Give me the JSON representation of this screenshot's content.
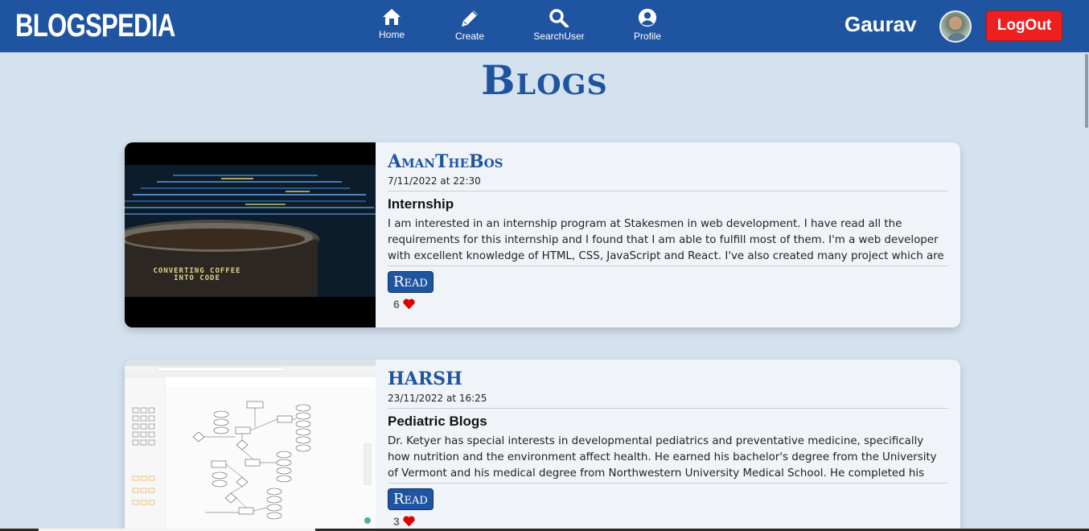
{
  "brand": "BLOGSPEDIA",
  "nav": [
    {
      "label": "Home",
      "icon": "home-icon"
    },
    {
      "label": "Create",
      "icon": "pencil-icon"
    },
    {
      "label": "SearchUser",
      "icon": "search-icon"
    },
    {
      "label": "Profile",
      "icon": "user-circle-icon"
    }
  ],
  "user": {
    "name": "Gaurav",
    "logout_label": "LogOut"
  },
  "page_title": "Blogs",
  "colors": {
    "primary": "#1f55a0",
    "danger": "#ef1f1f",
    "background": "#d4e2ef",
    "heart": "#e00000"
  },
  "posts": [
    {
      "author": "AmanTheBos",
      "date": "7/11/2022 at 22:30",
      "title": "Internship",
      "excerpt": "I am interested in an internship program at Stakesmen in web development. I have read all the requirements for this internship and I found that I am able to fulfill most of them. I'm a web developer with excellent knowledge of HTML, CSS, JavaScript and React. I've also created many project which are based upon HTML, CSS and JS and some of them are based on React. On a personal note, I am also",
      "read_label": "Read",
      "likes": "6",
      "image_caption": "CONVERTING COFFEE INTO CODE"
    },
    {
      "author": "HARSH",
      "date": "23/11/2022 at 16:25",
      "title": "Pediatric Blogs",
      "excerpt": "Dr. Ketyer has special interests in developmental pediatrics and preventative medicine, specifically how nutrition and the environment affect health. He earned his bachelor's degree from the University of Vermont and his medical degree from Northwestern University Medical School. He completed his residency at Children's Hospital of Pittsburgh.",
      "read_label": "Read",
      "likes": "3"
    }
  ]
}
